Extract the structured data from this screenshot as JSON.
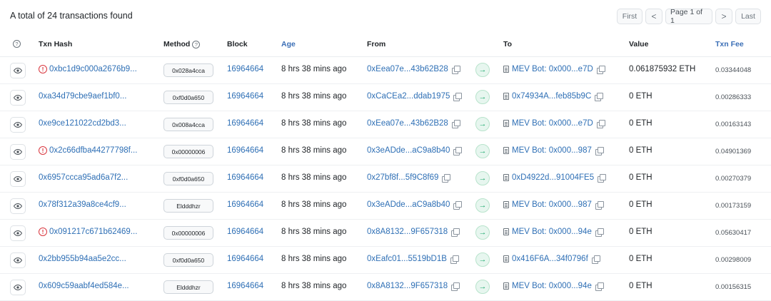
{
  "summary": "A total of 24 transactions found",
  "pagination": {
    "first": "First",
    "prev": "<",
    "info": "Page 1 of 1",
    "next": ">",
    "last": "Last"
  },
  "columns": {
    "help": "?",
    "txn_hash": "Txn Hash",
    "method": "Method",
    "block": "Block",
    "age": "Age",
    "from": "From",
    "to": "To",
    "value": "Value",
    "txn_fee": "Txn Fee"
  },
  "icons": {
    "view": "eye-icon",
    "error": "alert-circle-icon",
    "direction": "arrow-right-icon",
    "copy": "copy-icon",
    "contract": "document-icon"
  },
  "colors": {
    "link": "#2e6fb5",
    "error": "#d9363e",
    "direction": "#18a86b"
  },
  "rows": [
    {
      "failed": true,
      "hash": "0xbc1d9c000a2676b9...",
      "method": "0x028a4cca",
      "block": "16964664",
      "age": "8 hrs 38 mins ago",
      "from": "0xEea07e...43b62B28",
      "to": "MEV Bot: 0x000...e7D",
      "to_contract": true,
      "value": "0.061875932 ETH",
      "fee": "0.03344048"
    },
    {
      "failed": false,
      "hash": "0xa34d79cbe9aef1bf0...",
      "method": "0xf0d0a650",
      "block": "16964664",
      "age": "8 hrs 38 mins ago",
      "from": "0xCaCEa2...ddab1975",
      "to": "0x74934A...feb85b9C",
      "to_contract": true,
      "value": "0 ETH",
      "fee": "0.00286333"
    },
    {
      "failed": false,
      "hash": "0xe9ce121022cd2bd3...",
      "method": "0x008a4cca",
      "block": "16964664",
      "age": "8 hrs 38 mins ago",
      "from": "0xEea07e...43b62B28",
      "to": "MEV Bot: 0x000...e7D",
      "to_contract": true,
      "value": "0 ETH",
      "fee": "0.00163143"
    },
    {
      "failed": true,
      "hash": "0x2c66dfba44277798f...",
      "method": "0x00000006",
      "block": "16964664",
      "age": "8 hrs 38 mins ago",
      "from": "0x3eADde...aC9a8b40",
      "to": "MEV Bot: 0x000...987",
      "to_contract": true,
      "value": "0 ETH",
      "fee": "0.04901369"
    },
    {
      "failed": false,
      "hash": "0x6957ccca95ad6a7f2...",
      "method": "0xf0d0a650",
      "block": "16964664",
      "age": "8 hrs 38 mins ago",
      "from": "0x27bf8f...5f9C8f69",
      "to": "0xD4922d...91004FE5",
      "to_contract": true,
      "value": "0 ETH",
      "fee": "0.00270379"
    },
    {
      "failed": false,
      "hash": "0x78f312a39a8ce4cf9...",
      "method": "Eldddhzr",
      "block": "16964664",
      "age": "8 hrs 38 mins ago",
      "from": "0x3eADde...aC9a8b40",
      "to": "MEV Bot: 0x000...987",
      "to_contract": true,
      "value": "0 ETH",
      "fee": "0.00173159"
    },
    {
      "failed": true,
      "hash": "0x091217c671b62469...",
      "method": "0x00000006",
      "block": "16964664",
      "age": "8 hrs 38 mins ago",
      "from": "0x8A8132...9F657318",
      "to": "MEV Bot: 0x000...94e",
      "to_contract": true,
      "value": "0 ETH",
      "fee": "0.05630417"
    },
    {
      "failed": false,
      "hash": "0x2bb955b94aa5e2cc...",
      "method": "0xf0d0a650",
      "block": "16964664",
      "age": "8 hrs 38 mins ago",
      "from": "0xEafc01...5519bD1B",
      "to": "0x416F6A...34f0796f",
      "to_contract": true,
      "value": "0 ETH",
      "fee": "0.00298009"
    },
    {
      "failed": false,
      "hash": "0x609c59aabf4ed584e...",
      "method": "Eldddhzr",
      "block": "16964664",
      "age": "8 hrs 38 mins ago",
      "from": "0x8A8132...9F657318",
      "to": "MEV Bot: 0x000...94e",
      "to_contract": true,
      "value": "0 ETH",
      "fee": "0.00156315"
    }
  ]
}
